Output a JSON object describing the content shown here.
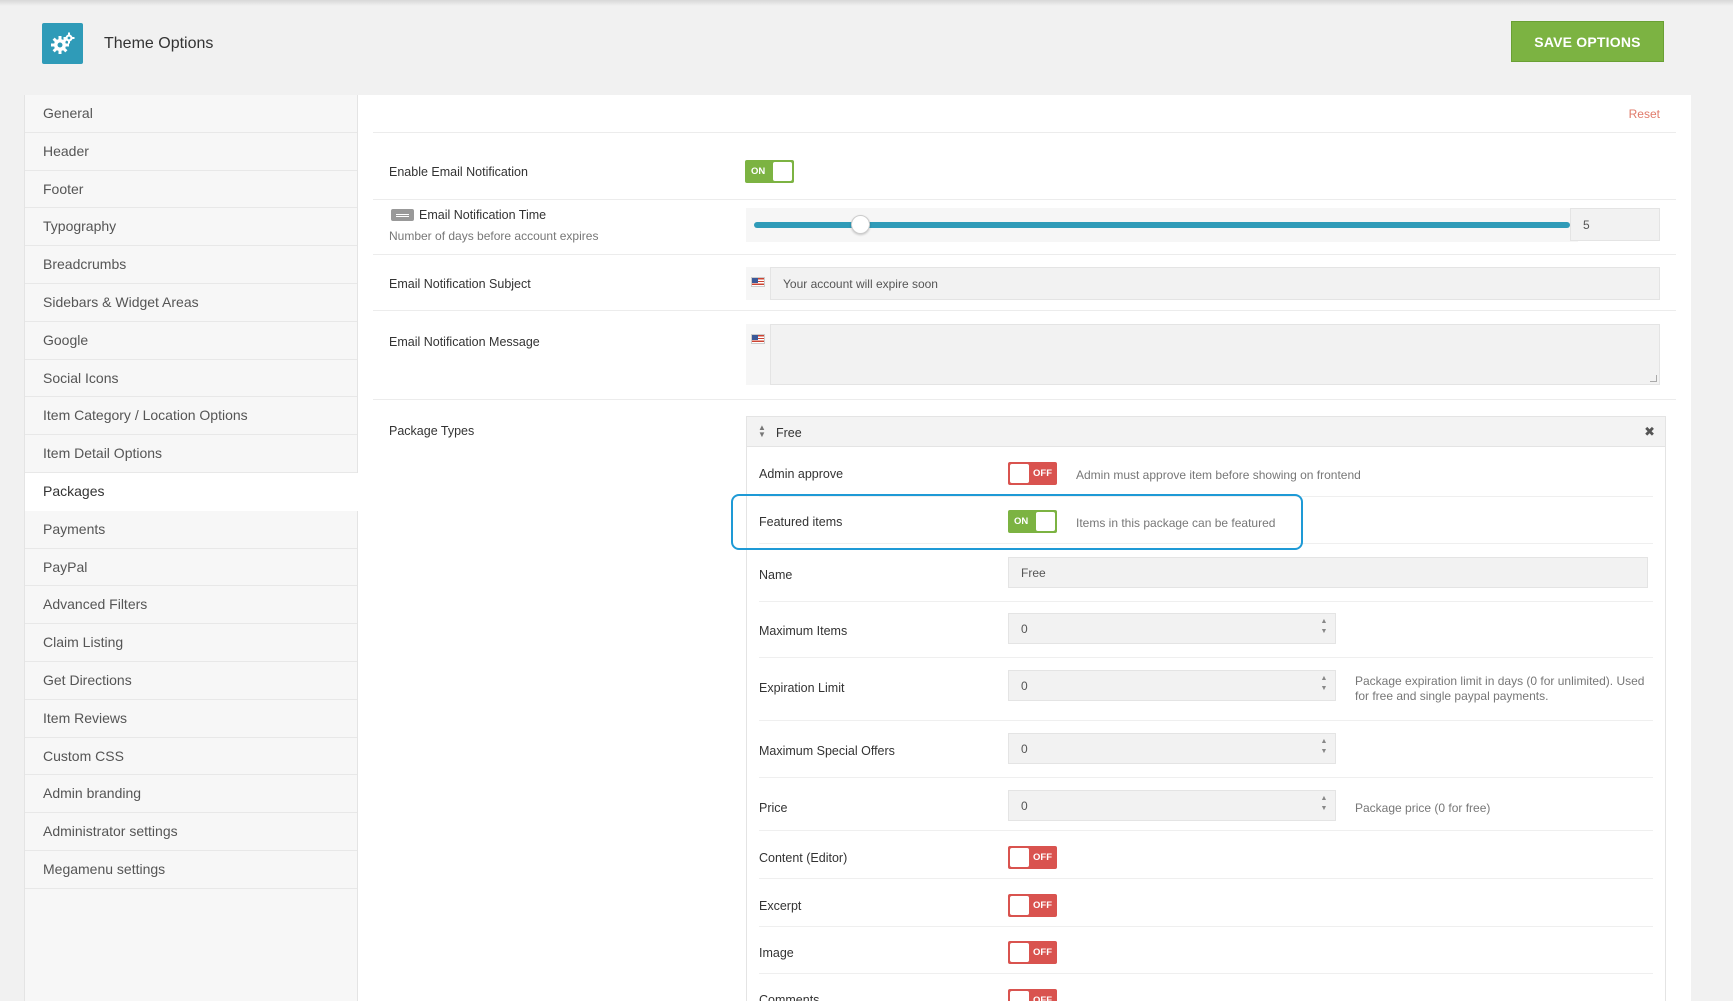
{
  "header": {
    "title": "Theme Options",
    "save_label": "SAVE OPTIONS",
    "logo_icon": "gears-icon"
  },
  "sidebar": {
    "items": [
      {
        "label": "General"
      },
      {
        "label": "Header"
      },
      {
        "label": "Footer"
      },
      {
        "label": "Typography"
      },
      {
        "label": "Breadcrumbs"
      },
      {
        "label": "Sidebars & Widget Areas"
      },
      {
        "label": "Google"
      },
      {
        "label": "Social Icons"
      },
      {
        "label": "Item Category / Location Options"
      },
      {
        "label": "Item Detail Options"
      },
      {
        "label": "Packages"
      },
      {
        "label": "Payments"
      },
      {
        "label": "PayPal"
      },
      {
        "label": "Advanced Filters"
      },
      {
        "label": "Claim Listing"
      },
      {
        "label": "Get Directions"
      },
      {
        "label": "Item Reviews"
      },
      {
        "label": "Custom CSS"
      },
      {
        "label": "Admin branding"
      },
      {
        "label": "Administrator settings"
      },
      {
        "label": "Megamenu settings"
      }
    ],
    "active_index": 10
  },
  "main": {
    "reset_label": "Reset",
    "email_notification": {
      "label": "Enable Email Notification",
      "state": "ON"
    },
    "notification_time": {
      "label": "Email Notification Time",
      "description": "Number of days before account expires",
      "value": "5",
      "slider_fraction": 0.13
    },
    "subject": {
      "label": "Email Notification Subject",
      "value": "Your account will expire soon"
    },
    "message": {
      "label": "Email Notification Message",
      "value": ""
    },
    "package_types": {
      "label": "Package Types",
      "package_name_header": "Free",
      "rows": {
        "admin_approve": {
          "label": "Admin approve",
          "state": "OFF",
          "help": "Admin must approve item before showing on frontend"
        },
        "featured": {
          "label": "Featured items",
          "state": "ON",
          "help": "Items in this package can be featured"
        },
        "name": {
          "label": "Name",
          "value": "Free"
        },
        "max_items": {
          "label": "Maximum Items",
          "value": "0"
        },
        "expiration": {
          "label": "Expiration Limit",
          "value": "0",
          "help_line1": "Package expiration limit in days (0 for unlimited). Used",
          "help_line2": "for free and single paypal payments."
        },
        "max_offers": {
          "label": "Maximum Special Offers",
          "value": "0"
        },
        "price": {
          "label": "Price",
          "value": "0",
          "help": "Package price (0 for free)"
        },
        "content": {
          "label": "Content (Editor)",
          "state": "OFF"
        },
        "excerpt": {
          "label": "Excerpt",
          "state": "OFF"
        },
        "image": {
          "label": "Image",
          "state": "OFF"
        },
        "comments": {
          "label": "Comments",
          "state": "OFF"
        }
      }
    }
  },
  "colors": {
    "accent": "#2f9bb8",
    "save_green": "#7cb342",
    "switch_on": "#7cb342",
    "switch_off": "#d9534f",
    "highlight": "#1e9ad6"
  }
}
